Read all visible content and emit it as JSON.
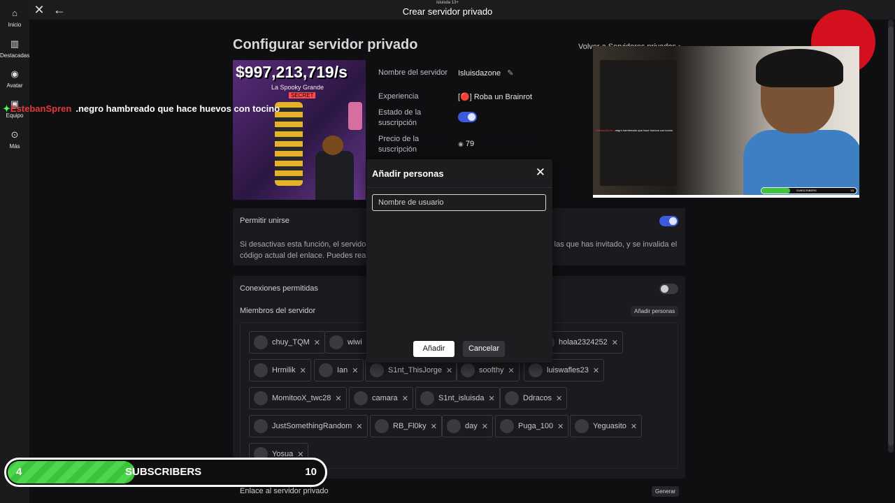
{
  "window": {
    "subtitle": "isluisda 13+",
    "title": "Crear servidor privado"
  },
  "sidebar": {
    "items": [
      {
        "label": "Inicio",
        "icon": "home-icon"
      },
      {
        "label": "Destacadas",
        "icon": "charts-icon"
      },
      {
        "label": "Avatar",
        "icon": "avatar-icon"
      },
      {
        "label": "Equipo",
        "icon": "inventory-icon"
      },
      {
        "label": "Más",
        "icon": "more-icon"
      }
    ]
  },
  "page": {
    "title": "Configurar servidor privado",
    "back_link": "Volver a Servidores privados ›"
  },
  "thumbnail": {
    "price": "$997,213,719/s",
    "caption": "La Spooky Grande",
    "badge": "SECRET"
  },
  "info": {
    "server_name_label": "Nombre del servidor",
    "server_name": "Isluisdazone",
    "experience_label": "Experiencia",
    "experience": "[🔴] Roba un Brainrot",
    "subscription_state_label": "Estado de la suscripción",
    "price_label": "Precio de la suscripción",
    "price": "79"
  },
  "join": {
    "label": "Permitir unirse",
    "desc_left": "Si desactivas esta función, el servidor",
    "desc_right": "la las que has invitado, y se invalida el",
    "desc_line2": "código actual del enlace. Puedes reac"
  },
  "connections": {
    "label": "Conexiones permitidas"
  },
  "members": {
    "label": "Miembros del servidor",
    "add_button": "Añadir personas",
    "chips": [
      "chuy_TQM",
      "wiwi",
      "holaa2324252",
      "Hrmilik",
      "Ian",
      "S1nt_ThisJorge",
      "soofthy",
      "luiswafles23",
      "MomitooX_twc28",
      "camara",
      "S1nt_isluisda",
      "Ddracos",
      "JustSomethingRandom",
      "RB_Fl0ky",
      "day",
      "Puga_100",
      "Yeguasito",
      "Yosua"
    ]
  },
  "link": {
    "label": "Enlace al servidor privado",
    "generate": "Generar"
  },
  "modal": {
    "title": "Añadir personas",
    "placeholder": "Nombre de usuario",
    "add": "Añadir",
    "cancel": "Cancelar"
  },
  "chat_overlay": {
    "user": "EstebanSpren",
    "message": ".negro hambreado que hace huevos con tocino"
  },
  "subscribers": {
    "current": "4",
    "label": "SUBSCRIBERS",
    "goal": "10",
    "progress": 0.4
  },
  "webcam": {
    "bar_label": "SUBSCRIBERS",
    "bar_goal": "10"
  },
  "colors": {
    "accent": "#3b5bdb",
    "record": "#d4101f",
    "progress": "#3ec43e"
  }
}
